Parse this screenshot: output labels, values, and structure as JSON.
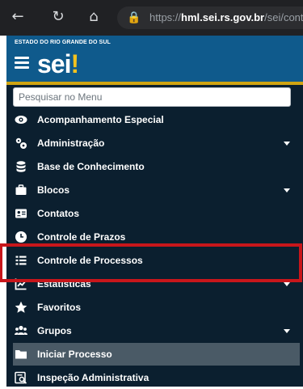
{
  "browser": {
    "url_scheme": "https://",
    "url_host": "hml.sei.rs.gov.br",
    "url_path": "/sei/cont"
  },
  "header": {
    "state_name": "ESTADO DO RIO GRANDE DO SUL",
    "logo_text": "sei",
    "logo_accent": "!"
  },
  "search": {
    "placeholder": "Pesquisar no Menu"
  },
  "menu": {
    "items": [
      {
        "label": "Acompanhamento Especial",
        "icon": "eye-icon",
        "has_submenu": false
      },
      {
        "label": "Administração",
        "icon": "gears-icon",
        "has_submenu": true
      },
      {
        "label": "Base de Conhecimento",
        "icon": "database-icon",
        "has_submenu": false
      },
      {
        "label": "Blocos",
        "icon": "briefcase-icon",
        "has_submenu": true
      },
      {
        "label": "Contatos",
        "icon": "address-card-icon",
        "has_submenu": false
      },
      {
        "label": "Controle de Prazos",
        "icon": "clock-icon",
        "has_submenu": false
      },
      {
        "label": "Controle de Processos",
        "icon": "list-icon",
        "has_submenu": false
      },
      {
        "label": "Estatísticas",
        "icon": "chart-icon",
        "has_submenu": true
      },
      {
        "label": "Favoritos",
        "icon": "star-icon",
        "has_submenu": false
      },
      {
        "label": "Grupos",
        "icon": "users-icon",
        "has_submenu": true
      },
      {
        "label": "Iniciar Processo",
        "icon": "folder-icon",
        "has_submenu": false,
        "active": true
      },
      {
        "label": "Inspeção Administrativa",
        "icon": "magnifier-icon",
        "has_submenu": false
      }
    ]
  },
  "colors": {
    "header_blue": "#0f5a8c",
    "accent_gold": "#cfa412",
    "sidebar_bg": "#0b1f2f",
    "highlight_red": "#c8161b",
    "active_bg": "#4a5a66"
  }
}
